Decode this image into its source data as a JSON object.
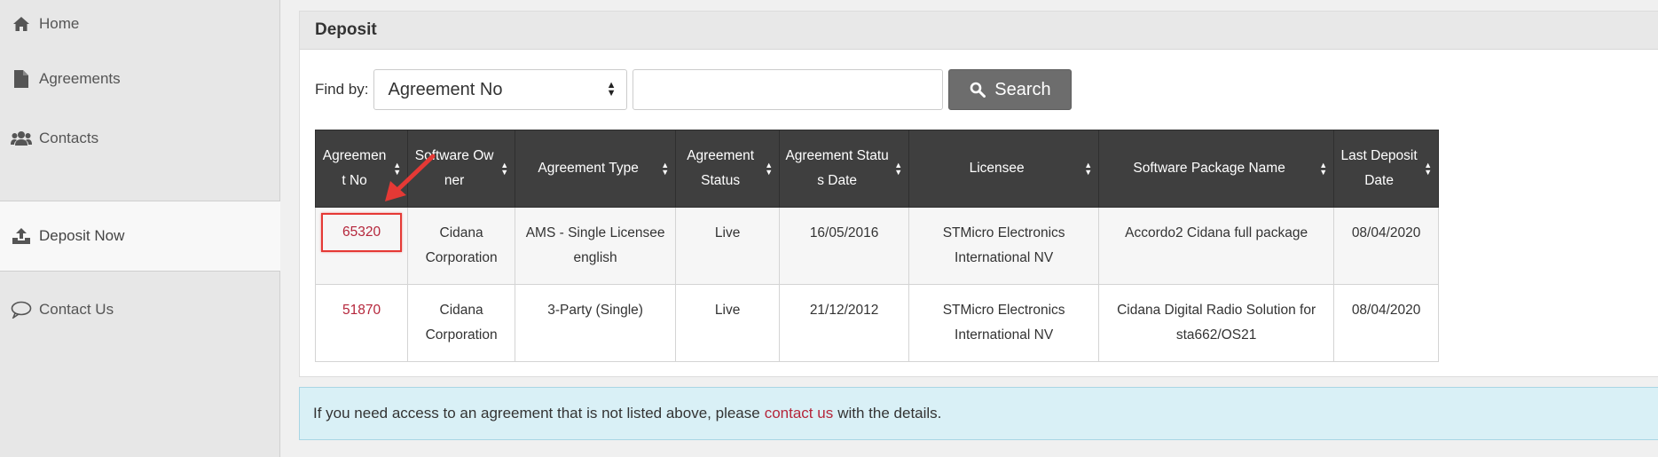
{
  "sidebar": {
    "items": [
      {
        "label": "Home",
        "icon": "home-icon"
      },
      {
        "label": "Agreements",
        "icon": "file-icon"
      },
      {
        "label": "Contacts",
        "icon": "users-icon"
      },
      {
        "label": "Deposit Now",
        "icon": "upload-icon",
        "active": true
      },
      {
        "label": "Contact Us",
        "icon": "speech-bubble-icon"
      }
    ]
  },
  "panel": {
    "title": "Deposit",
    "find_label": "Find by:",
    "find_by_selected": "Agreement No",
    "search_value": "",
    "search_button": "Search"
  },
  "table": {
    "columns": [
      "Agreement No",
      "Software Owner",
      "Agreement Type",
      "Agreement Status",
      "Agreement Status Date",
      "Licensee",
      "Software Package Name",
      "Last Deposit Date"
    ],
    "rows": [
      {
        "agreement_no": "65320",
        "software_owner": "Cidana Corporation",
        "agreement_type": "AMS - Single Licensee english",
        "status": "Live",
        "status_date": "16/05/2016",
        "licensee": "STMicro Electronics International NV",
        "package_name": "Accordo2 Cidana full package",
        "last_deposit_date": "08/04/2020",
        "highlighted": true
      },
      {
        "agreement_no": "51870",
        "software_owner": "Cidana Corporation",
        "agreement_type": "3-Party (Single)",
        "status": "Live",
        "status_date": "21/12/2012",
        "licensee": "STMicro Electronics International NV",
        "package_name": "Cidana Digital Radio Solution for sta662/OS21",
        "last_deposit_date": "08/04/2020",
        "highlighted": false
      }
    ]
  },
  "alert": {
    "text_before": "If you need access to an agreement that is not listed above, please",
    "link_text": "contact us",
    "text_after": "with the details."
  },
  "colors": {
    "link": "#b5263b",
    "table_header": "#3f3f3f",
    "search_button": "#6d6d6d",
    "highlight": "#e53935",
    "alert_bg": "#d9f0f6"
  }
}
